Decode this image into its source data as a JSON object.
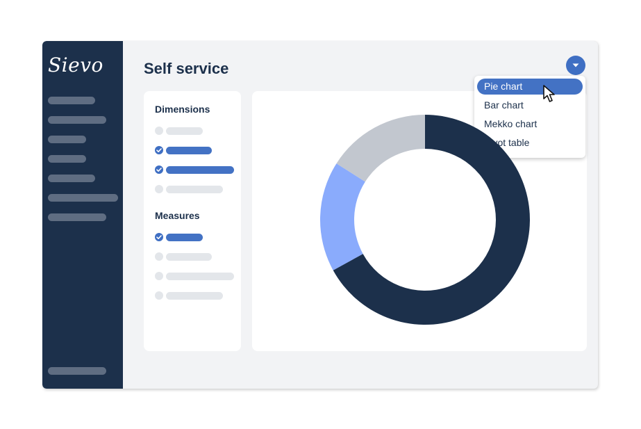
{
  "app": {
    "logo_text": "Sievo",
    "page_title": "Self service"
  },
  "panel": {
    "dimensions_heading": "Dimensions",
    "dimensions": [
      {
        "checked": false
      },
      {
        "checked": true
      },
      {
        "checked": true
      },
      {
        "checked": false
      }
    ],
    "measures_heading": "Measures",
    "measures": [
      {
        "checked": true
      },
      {
        "checked": false
      },
      {
        "checked": false
      },
      {
        "checked": false
      }
    ]
  },
  "chart_type_menu": {
    "toggle_icon": "caret-down-icon",
    "items": [
      "Pie chart",
      "Bar chart",
      "Mekko chart",
      "Pivot table"
    ],
    "selected": "Pie chart"
  },
  "chart_data": {
    "type": "pie",
    "style": "donut",
    "values": [
      0.67,
      0.17,
      0.16
    ],
    "colors": [
      "#1c304b",
      "#8aabfc",
      "#c2c7cf"
    ]
  },
  "colors": {
    "sidebar": "#1c304b",
    "accent": "#4372c4",
    "background": "#f2f3f5"
  }
}
